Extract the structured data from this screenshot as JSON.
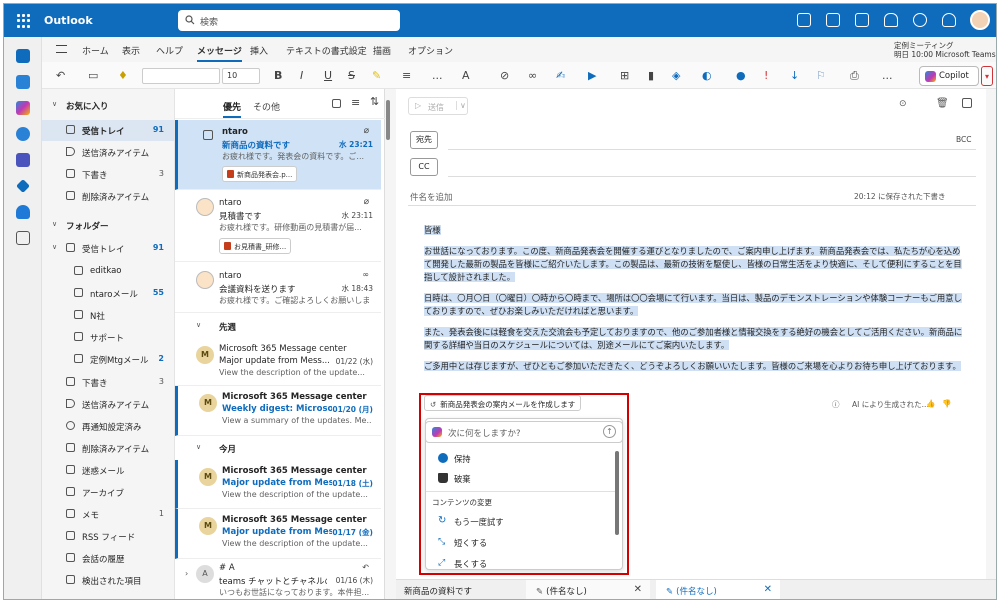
{
  "app": {
    "title": "Outlook",
    "search_placeholder": "検索"
  },
  "colors": {
    "brand": "#0f6cbd",
    "highlight": "#cfe0f4",
    "callout": "#d40000"
  },
  "ribbon_tabs": [
    "ホーム",
    "表示",
    "ヘルプ",
    "メッセージ",
    "挿入",
    "テキストの書式設定",
    "描画",
    "オプション"
  ],
  "active_tab": "メッセージ",
  "notice": {
    "line1": "定例ミーティング",
    "line2": "明日 10:00 Microsoft Teams ..."
  },
  "toolbar": {
    "font_size": "10",
    "bold": "B",
    "italic": "I",
    "underline": "U",
    "strike": "S",
    "more": "...",
    "copilot_label": "Copilot"
  },
  "folders": {
    "favorites_label": "お気に入り",
    "favorites": [
      {
        "label": "受信トレイ",
        "count": "91",
        "icon": "inbox-icon"
      },
      {
        "label": "送信済みアイテム",
        "count": "",
        "icon": "send-icon"
      },
      {
        "label": "下書き",
        "count": "3",
        "icon": "pencil-icon"
      },
      {
        "label": "削除済みアイテム",
        "count": "",
        "icon": "trash-icon"
      }
    ],
    "folder_section_label": "フォルダー",
    "inbox": {
      "label": "受信トレイ",
      "count": "91"
    },
    "inbox_children": [
      {
        "label": "editkao",
        "count": ""
      },
      {
        "label": "ntaroメール",
        "count": "55"
      },
      {
        "label": "N社",
        "count": ""
      },
      {
        "label": "サポート",
        "count": ""
      },
      {
        "label": "定例Mtgメール",
        "count": "2"
      }
    ],
    "others": [
      {
        "label": "下書き",
        "count": "3",
        "icon": "pencil-icon"
      },
      {
        "label": "送信済みアイテム",
        "count": "",
        "icon": "send-icon"
      },
      {
        "label": "再通知設定済み",
        "count": "",
        "icon": "clock-icon"
      },
      {
        "label": "削除済みアイテム",
        "count": "",
        "icon": "trash-icon"
      },
      {
        "label": "迷惑メール",
        "count": "",
        "icon": "junk-icon"
      },
      {
        "label": "アーカイブ",
        "count": "",
        "icon": "archive-icon"
      },
      {
        "label": "メモ",
        "count": "1",
        "icon": "note-icon"
      },
      {
        "label": "RSS フィード",
        "count": "",
        "icon": "folder-icon"
      },
      {
        "label": "会話の履歴",
        "count": "",
        "icon": "folder-icon"
      },
      {
        "label": "検出された項目",
        "count": "",
        "icon": "folder-icon"
      }
    ]
  },
  "list": {
    "tab_focused": "優先",
    "tab_other": "その他",
    "group_last_week": "先週",
    "group_this_month": "今月",
    "messages": [
      {
        "from": "ntaro",
        "subject": "新商品の資料です",
        "date": "水 23:21",
        "preview": "お疲れ様です。発表会の資料です。ご...",
        "attachment": "新商品発表会.p..."
      },
      {
        "from": "ntaro",
        "subject": "見積書です",
        "date": "水 23:11",
        "preview": "お疲れ様です。研修動画の見積書が届...",
        "attachment": "お見積書_研修..."
      },
      {
        "from": "ntaro",
        "subject": "会議資料を送ります",
        "date": "水 18:43",
        "preview": "お疲れ様です。ご確認よろしくお願いしま..."
      },
      {
        "avatar": "M",
        "from": "Microsoft 365 Message center",
        "subject": "Major update from Mess...",
        "date": "01/22 (水)",
        "preview": "View the description of the update..."
      },
      {
        "avatar": "M",
        "from": "Microsoft 365 Message center",
        "subject": "Weekly digest: Microsof...",
        "date": "01/20 (月)",
        "preview": "View a summary of the updates. Me..."
      },
      {
        "avatar": "M",
        "from": "Microsoft 365 Message center",
        "subject": "Major update from Mess...",
        "date": "01/18 (土)",
        "preview": "View the description of the update..."
      },
      {
        "avatar": "M",
        "from": "Microsoft 365 Message center",
        "subject": "Major update from Mess...",
        "date": "01/17 (金)",
        "preview": "View the description of the update..."
      },
      {
        "avatar": "A",
        "from": "# A",
        "subject": "teams チャットとチャネルの...",
        "date": "01/16 (木)",
        "preview": "いつもお世話になっております。本件担..."
      }
    ]
  },
  "compose": {
    "send_label": "送信",
    "to_label": "宛先",
    "cc_label": "CC",
    "bcc_label": "BCC",
    "subject_placeholder": "件名を追加",
    "saved_note": "20:12 に保存された下書き",
    "greeting": "皆様",
    "para1": "お世話になっております。この度、新商品発表会を開催する運びとなりましたので、ご案内申し上げます。新商品発表会では、私たちが心を込めて開発した最新の製品を皆様にご紹介いたします。この製品は、最新の技術を駆使し、皆様の日常生活をより快適に、そして便利にすることを目指して設計されました。",
    "para2": "日時は、〇月〇日（〇曜日）〇時から〇時まで、場所は〇〇会場にて行います。当日は、製品のデモンストレーションや体験コーナーもご用意しておりますので、ぜひお楽しみいただければと思います。",
    "para3": "また、発表会後には軽食を交えた交流会も予定しておりますので、他のご参加者様と情報交換をする絶好の機会としてご活用ください。新商品に関する詳細や当日のスケジュールについては、別途メールにてご案内いたします。",
    "para4": "ご多用中とは存じますが、ぜひともご参加いただきたく、どうぞよろしくお願いいたします。皆様のご来場を心よりお待ち申し上げております。",
    "ai_prompt": "新商品発表会の案内メールを作成します",
    "ai_generated": "AI により生成された...",
    "ask_placeholder": "次に何をしますか?",
    "menu": {
      "keep": "保持",
      "discard": "破棄",
      "section": "コンテンツの変更",
      "retry": "もう一度試す",
      "shorter": "短くする",
      "longer": "長くする"
    }
  },
  "bottom_tabs": [
    "新商品の資料です",
    "(件名なし)",
    "(件名なし)"
  ]
}
